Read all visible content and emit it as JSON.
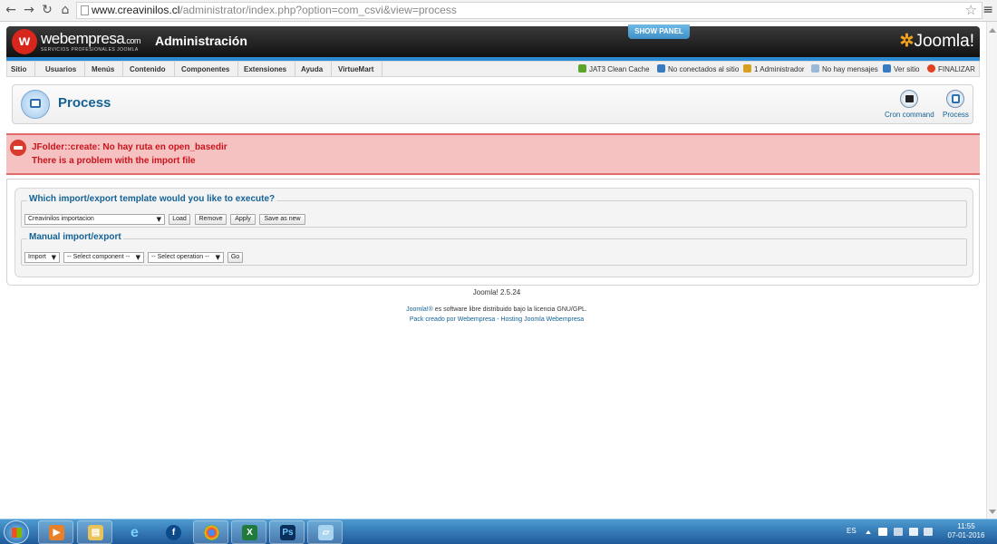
{
  "browser": {
    "url_host": "www.creavinilos.cl",
    "url_path": "/administrator/index.php?option=com_csvi&view=process"
  },
  "header": {
    "brand_main": "webempresa",
    "brand_com": ".com",
    "brand_sub": "SERVICIOS PROFESIONALES JOOMLA",
    "title": "Administración",
    "show_panel": "SHOW PANEL",
    "joomla_logo": "Joomla!"
  },
  "menu": {
    "items": [
      "Sitio",
      "Usuarios",
      "Menús",
      "Contenido",
      "Componentes",
      "Extensiones",
      "Ayuda",
      "VirtueMart"
    ],
    "status": {
      "cache": "JAT3 Clean Cache",
      "site": "No conectados al sitio",
      "admin": "1 Administrador",
      "messages": "No hay mensajes",
      "view_site": "Ver sitio",
      "logout": "FINALIZAR"
    }
  },
  "toolbar": {
    "page_title": "Process",
    "cron_label": "Cron command",
    "process_label": "Process"
  },
  "error": {
    "line1": "JFolder::create: No hay ruta en open_basedir",
    "line2": "There is a problem with the import file"
  },
  "template_section": {
    "legend": "Which import/export template would you like to execute?",
    "selected_template": "Creavinilos importacion",
    "load": "Load",
    "remove": "Remove",
    "apply": "Apply",
    "save_as_new": "Save as new"
  },
  "manual_section": {
    "legend": "Manual import/export",
    "action": "Import",
    "component": "-- Select component --",
    "operation": "-- Select operation --",
    "go": "Go"
  },
  "footer": {
    "version": "Joomla! 2.5.24",
    "license_link": "Joomla!®",
    "license_text": " es software libre distribuido bajo la licencia GNU/GPL.",
    "pack": "Pack creado por Webempresa - Hosting Joomla Webempresa"
  },
  "taskbar": {
    "lang": "ES",
    "time": "11:55",
    "date": "07-01-2016",
    "apps": [
      "media-player-icon",
      "explorer-icon",
      "ie-icon",
      "app-icon",
      "chrome-icon",
      "excel-icon",
      "photoshop-icon",
      "notepad-icon"
    ]
  },
  "colors": {
    "accent_blue": "#146295",
    "error_red": "#c8141c",
    "error_bg": "#f5c1c1"
  }
}
